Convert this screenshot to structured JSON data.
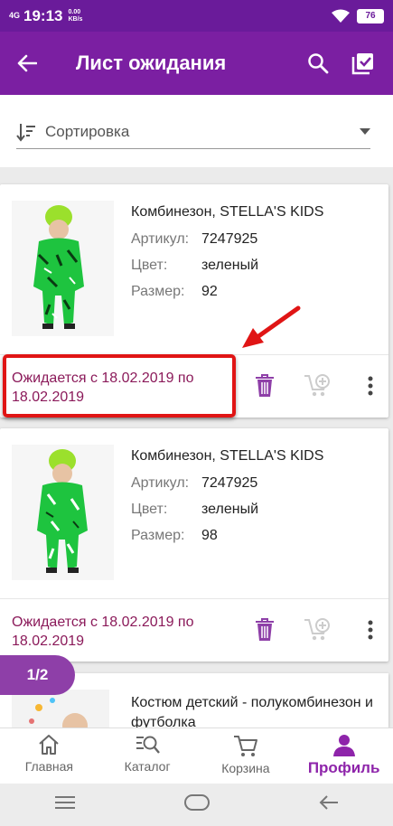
{
  "status_bar": {
    "network": "4G",
    "time": "19:13",
    "speed": "0.00 KB/s",
    "battery": "76"
  },
  "app_bar": {
    "title": "Лист ожидания"
  },
  "sort": {
    "label": "Сортировка"
  },
  "items": [
    {
      "name": "Комбинезон, STELLA'S KIDS",
      "article_label": "Артикул:",
      "article": "7247925",
      "color_label": "Цвет:",
      "color": "зеленый",
      "size_label": "Размер:",
      "size": "92",
      "expected": "Ожидается с 18.02.2019 по 18.02.2019"
    },
    {
      "name": "Комбинезон, STELLA'S KIDS",
      "article_label": "Артикул:",
      "article": "7247925",
      "color_label": "Цвет:",
      "color": "зеленый",
      "size_label": "Размер:",
      "size": "98",
      "expected": "Ожидается с 18.02.2019 по 18.02.2019"
    },
    {
      "name": "Костюм детский - полукомбинезон и футболка"
    }
  ],
  "pagination": {
    "label": "1/2"
  },
  "bottom_nav": [
    {
      "label": "Главная",
      "icon": "home-icon"
    },
    {
      "label": "Каталог",
      "icon": "catalog-search-icon"
    },
    {
      "label": "Корзина",
      "icon": "cart-icon"
    },
    {
      "label": "Профиль",
      "icon": "profile-icon",
      "active": true
    }
  ],
  "colors": {
    "primary": "#7b1fa2",
    "status_bar": "#6a1b9a",
    "accent": "#8e24aa",
    "expected_text": "#8b1a5a",
    "highlight": "#e01515"
  }
}
